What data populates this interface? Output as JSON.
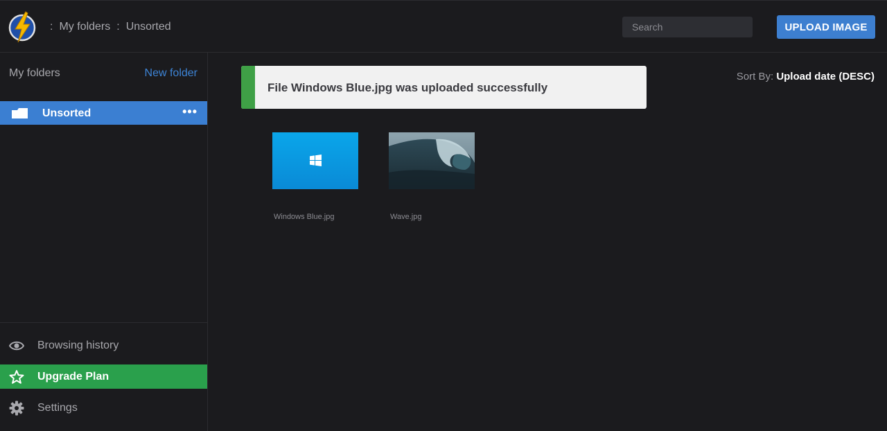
{
  "header": {
    "breadcrumb": [
      ":",
      "My folders",
      ":",
      "Unsorted"
    ],
    "search_placeholder": "Search",
    "upload_label": "UPLOAD IMAGE"
  },
  "sidebar": {
    "title": "My folders",
    "new_folder_label": "New folder",
    "folders": [
      {
        "label": "Unsorted",
        "menu": "•••"
      }
    ],
    "bottom": {
      "history": "Browsing history",
      "upgrade": "Upgrade Plan",
      "settings": "Settings"
    }
  },
  "toast": {
    "message": "File Windows Blue.jpg was uploaded successfully",
    "accent": "#3fa046"
  },
  "sort": {
    "label": "Sort By:",
    "value": "Upload date (DESC)"
  },
  "images": [
    {
      "name": "Windows Blue.jpg"
    },
    {
      "name": "Wave.jpg"
    }
  ],
  "colors": {
    "accent": "#3d7fd0",
    "upgrade": "#2aa04c"
  }
}
